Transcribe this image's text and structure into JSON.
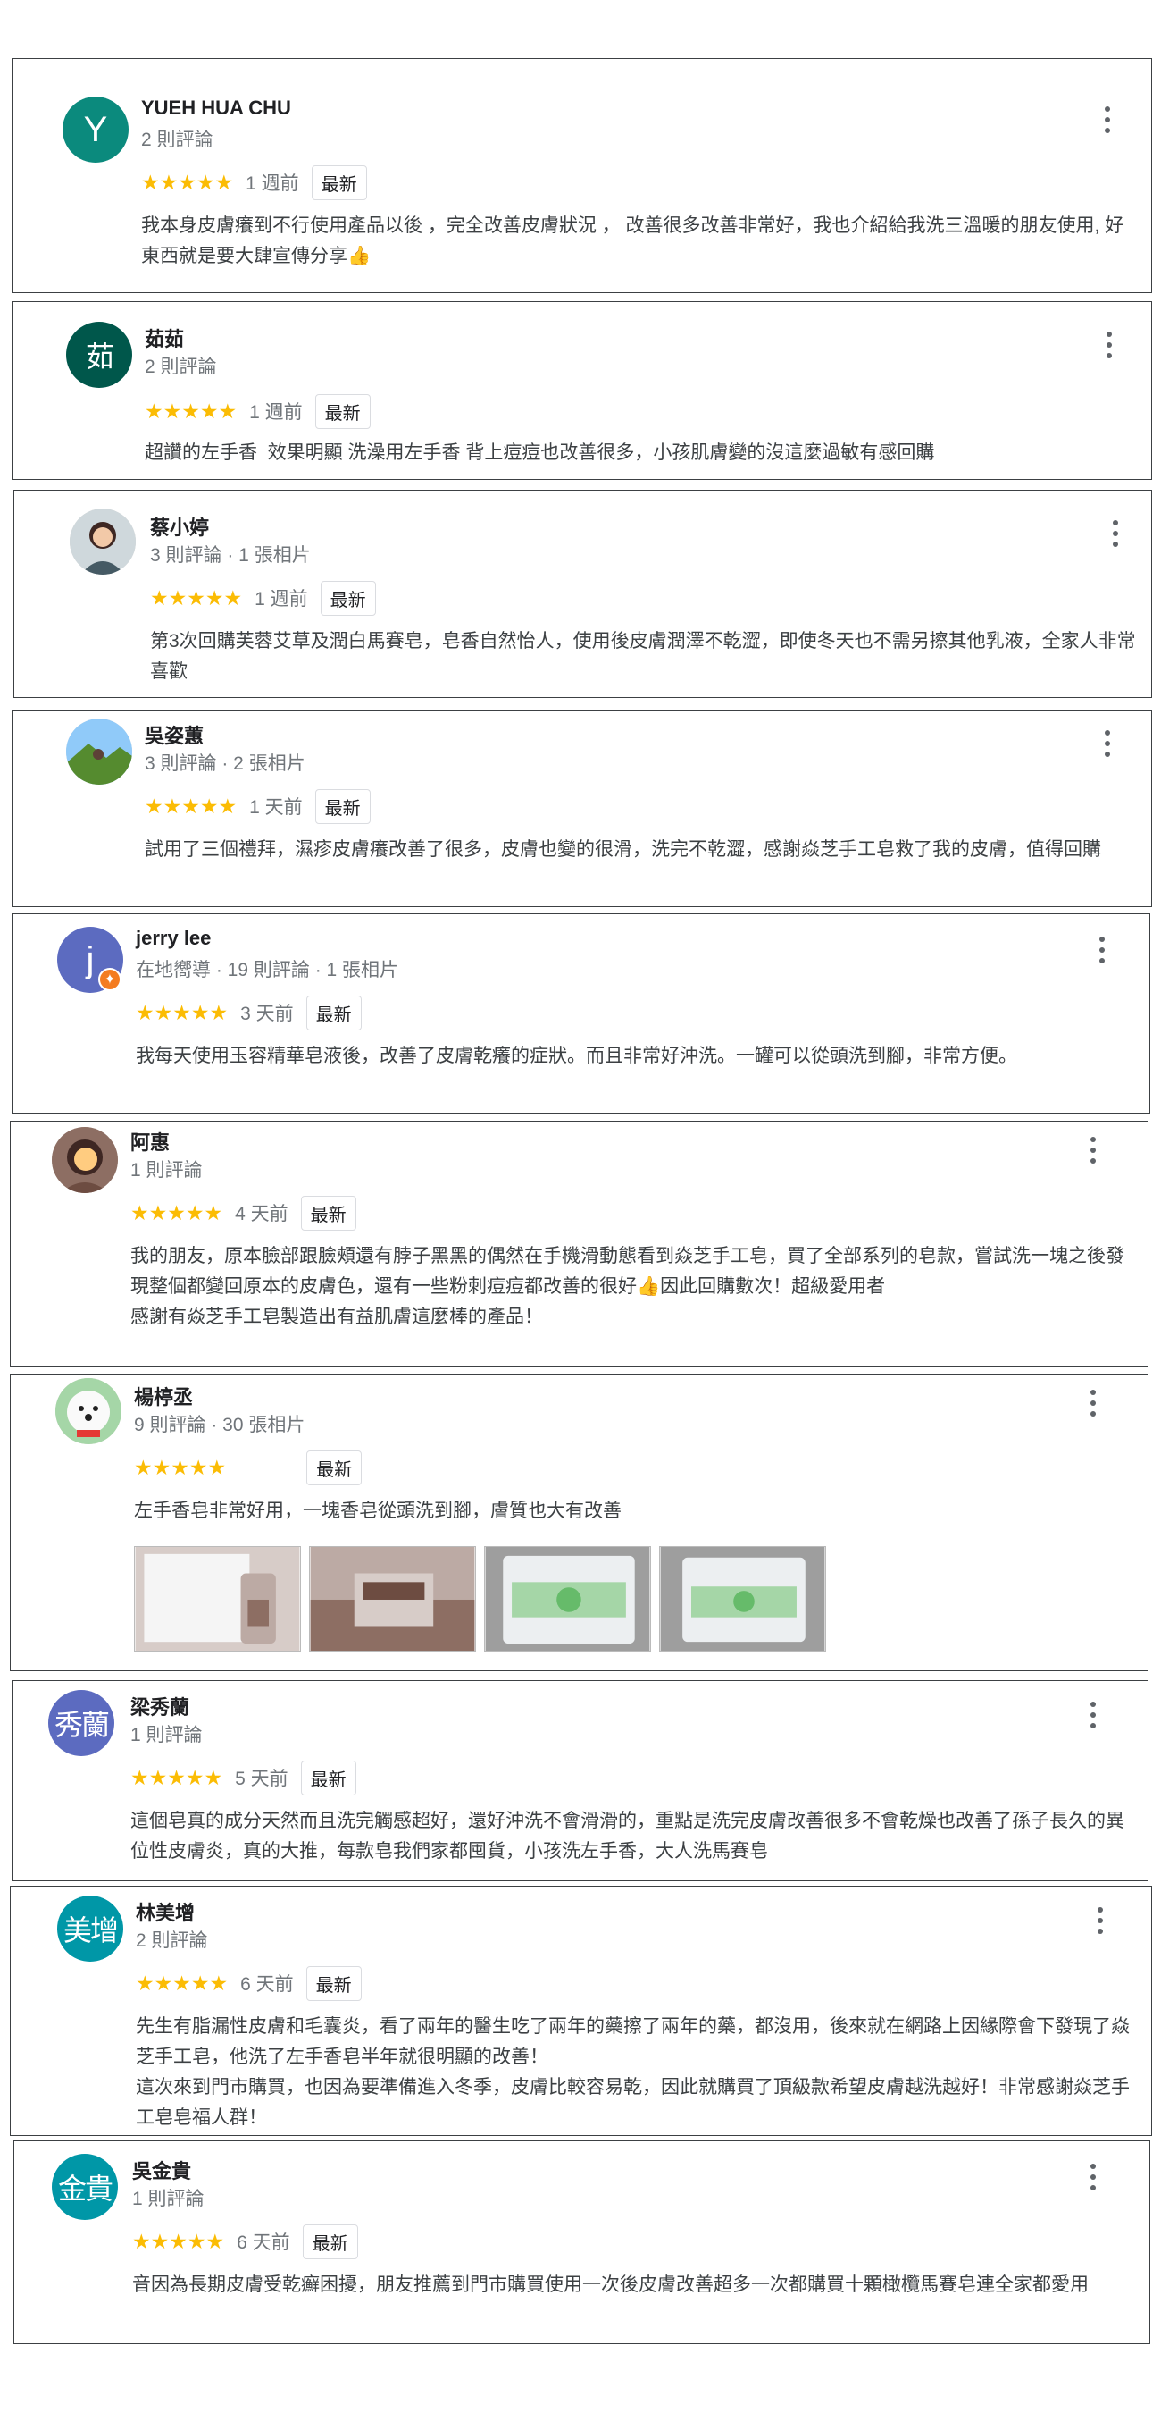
{
  "badge_label": "最新",
  "colors": {
    "star": "#fbbc04",
    "border": "#3c4043",
    "meta": "#70757a"
  },
  "reviews": [
    {
      "name": "YUEH HUA CHU",
      "avatar": {
        "type": "letter",
        "text": "Y",
        "color": "#0b8a7d"
      },
      "meta": "2 則評論",
      "stars": "★★★★★",
      "when": "1 週前",
      "text": "我本身皮膚癢到不行使用產品以後 ，完全改善皮膚狀況 ， 改善很多改善非常好，我也介紹給我洗三溫暖的朋友使用, 好東西就是要大肆宣傳分享👍"
    },
    {
      "name": "茹茹",
      "avatar": {
        "type": "letter",
        "text": "茹",
        "color": "#00574b"
      },
      "meta": "2 則評論",
      "stars": "★★★★★",
      "when": "1 週前",
      "text": "超讚的左手香  效果明顯 洗澡用左手香 背上痘痘也改善很多，小孩肌膚變的沒這麼過敏有感回購"
    },
    {
      "name": "蔡小婷",
      "avatar": {
        "type": "photo",
        "icon": "person-photo"
      },
      "meta": "3 則評論 · 1 張相片",
      "stars": "★★★★★",
      "when": "1 週前",
      "text": "第3次回購芙蓉艾草及潤白馬賽皂，皂香自然怡人，使用後皮膚潤澤不乾澀，即使冬天也不需另擦其他乳液，全家人非常喜歡"
    },
    {
      "name": "吳姿蕙",
      "avatar": {
        "type": "photo",
        "icon": "landscape-photo"
      },
      "meta": "3 則評論 · 2 張相片",
      "stars": "★★★★★",
      "when": "1 天前",
      "text": "試用了三個禮拜，濕疹皮膚癢改善了很多，皮膚也變的很滑，洗完不乾澀，感謝焱芝手工皂救了我的皮膚，值得回購"
    },
    {
      "name": "jerry lee",
      "avatar": {
        "type": "letter",
        "text": "j",
        "color": "#5c6bc0",
        "guide": true
      },
      "meta": "在地嚮導 · 19 則評論 · 1 張相片",
      "stars": "★★★★★",
      "when": "3 天前",
      "text": "我每天使用玉容精華皂液後，改善了皮膚乾癢的症狀。而且非常好沖洗。一罐可以從頭洗到腳，非常方便。"
    },
    {
      "name": "阿惠",
      "avatar": {
        "type": "photo",
        "icon": "person-photo"
      },
      "meta": "1 則評論",
      "stars": "★★★★★",
      "when": "4 天前",
      "text": "我的朋友，原本臉部跟臉頰還有脖子黑黑的偶然在手機滑動態看到焱芝手工皂，買了全部系列的皂款，嘗試洗一塊之後發現整個都變回原本的皮膚色，還有一些粉刺痘痘都改善的很好👍因此回購數次！超級愛用者\n感謝有焱芝手工皂製造出有益肌膚這麼棒的產品！"
    },
    {
      "name": "楊楟丞",
      "avatar": {
        "type": "photo",
        "icon": "dog-photo"
      },
      "meta": "9 則評論 · 30 張相片",
      "stars": "★★★★★",
      "when": "",
      "text": "左手香皂非常好用，一塊香皂從頭洗到腳，膚質也大有改善"
    },
    {
      "name": "梁秀蘭",
      "avatar": {
        "type": "letter",
        "text": "秀蘭",
        "color": "#5c6bc0"
      },
      "meta": "1 則評論",
      "stars": "★★★★★",
      "when": "5 天前",
      "text": "這個皂真的成分天然而且洗完觸感超好，還好沖洗不會滑滑的，重點是洗完皮膚改善很多不會乾燥也改善了孫子長久的異位性皮膚炎，真的大推，每款皂我們家都囤貨，小孩洗左手香，大人洗馬賽皂"
    },
    {
      "name": "林美增",
      "avatar": {
        "type": "letter",
        "text": "美增",
        "color": "#0097a7"
      },
      "meta": "2 則評論",
      "stars": "★★★★★",
      "when": "6 天前",
      "text": "先生有脂漏性皮膚和毛囊炎，看了兩年的醫生吃了兩年的藥擦了兩年的藥，都沒用，後來就在網路上因緣際會下發現了焱芝手工皂，他洗了左手香皂半年就很明顯的改善！\n這次來到門市購買，也因為要準備進入冬季，皮膚比較容易乾，因此就購買了頂級款希望皮膚越洗越好！非常感謝焱芝手工皂皂福人群！"
    },
    {
      "name": "吳金貴",
      "avatar": {
        "type": "letter",
        "text": "金貴",
        "color": "#0097a7"
      },
      "meta": "1 則評論",
      "stars": "★★★★★",
      "when": "6 天前",
      "text": "音因為長期皮膚受乾癬困擾，朋友推薦到門市購買使用一次後皮膚改善超多一次都購買十顆橄欖馬賽皂連全家都愛用"
    }
  ]
}
